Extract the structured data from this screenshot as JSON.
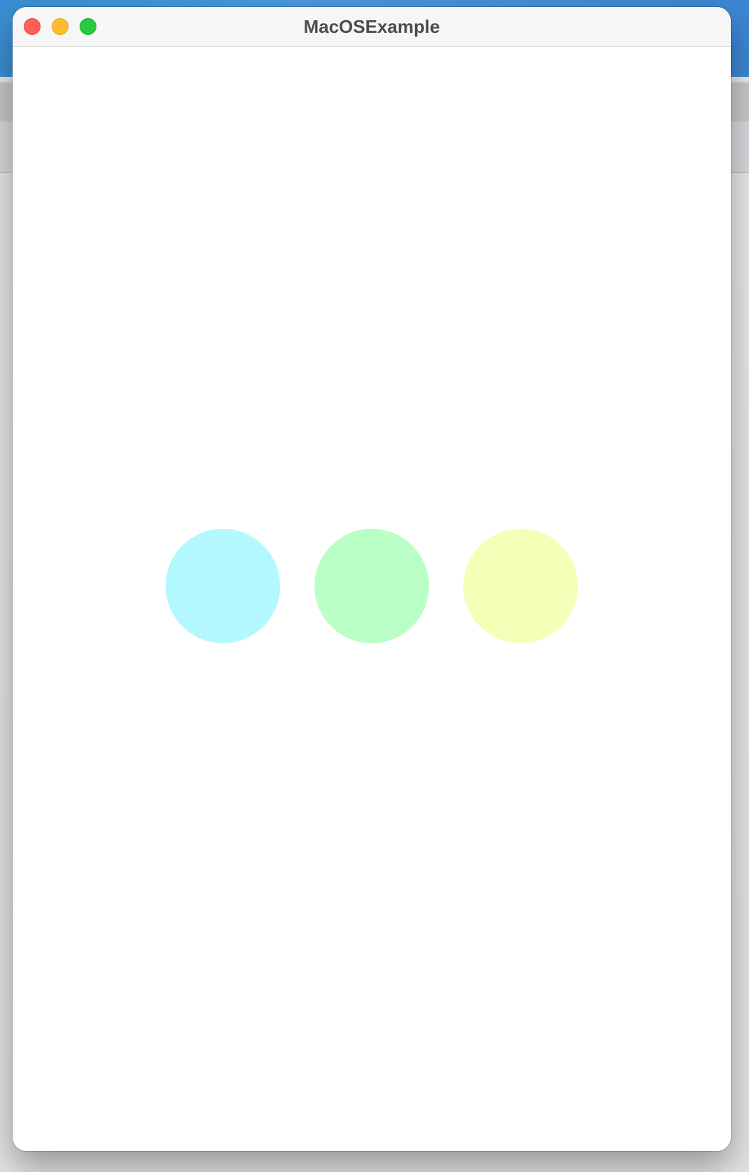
{
  "window": {
    "title": "MacOSExample"
  },
  "traffic_lights": {
    "close_color": "#fe5f57",
    "minimize_color": "#febc2e",
    "zoom_color": "#28c840"
  },
  "dots": [
    {
      "name": "cyan",
      "color": "#b3f8ff"
    },
    {
      "name": "green",
      "color": "#b9ffc6"
    },
    {
      "name": "yellow",
      "color": "#f4ffb8"
    }
  ],
  "backdrop": {
    "chevron_glyph": "⌄"
  }
}
